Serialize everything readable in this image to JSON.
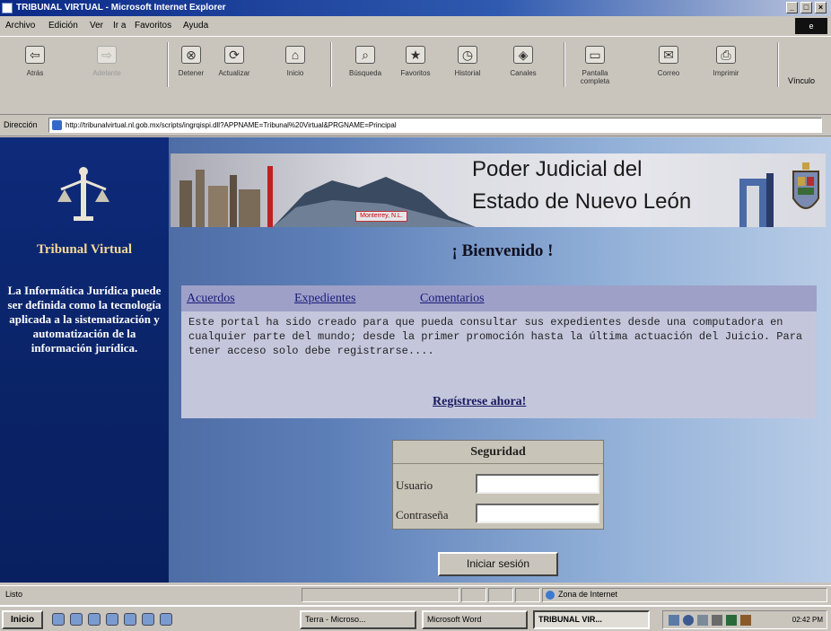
{
  "window": {
    "title": "TRIBUNAL VIRTUAL - Microsoft Internet Explorer"
  },
  "menu": [
    "Archivo",
    "Edición",
    "Ver",
    "Ir a",
    "Favoritos",
    "Ayuda"
  ],
  "toolbar": [
    {
      "label": "Atrás",
      "icon": "back-icon"
    },
    {
      "label": "Adelante",
      "icon": "forward-icon"
    },
    {
      "label": "Detener",
      "icon": "stop-icon"
    },
    {
      "label": "Actualizar",
      "icon": "refresh-icon"
    },
    {
      "label": "Inicio",
      "icon": "home-icon"
    },
    {
      "label": "Búsqueda",
      "icon": "search-icon"
    },
    {
      "label": "Favoritos",
      "icon": "favorites-icon"
    },
    {
      "label": "Historial",
      "icon": "history-icon"
    },
    {
      "label": "Canales",
      "icon": "channels-icon"
    },
    {
      "label": "Pantalla completa",
      "icon": "fullscreen-icon"
    },
    {
      "label": "Correo",
      "icon": "mail-icon"
    },
    {
      "label": "Imprimir",
      "icon": "print-icon"
    }
  ],
  "links_label": "Vínculo",
  "address": {
    "label": "Dirección",
    "url": "http://tribunalvirtual.nl.gob.mx/scripts/ingrqispi.dll?APPNAME=Tribunal%20Virtual&PRGNAME=Principal"
  },
  "sidebar": {
    "title": "Tribunal Virtual",
    "description": "La Informática Jurídica puede ser definida como la tecnología aplicada a la sistematización y automatización de la información jurídica."
  },
  "banner": {
    "line1": "Poder Judicial del",
    "line2": "Estado de Nuevo León",
    "caption": "Monterrey, N.L."
  },
  "welcome": "¡ Bienvenido !",
  "nav": [
    "Acuerdos",
    "Expedientes",
    "Comentarios"
  ],
  "intro": "Este portal ha sido creado para que pueda consultar sus expedientes desde una computadora en cualquier parte del mundo; desde la primer promoción hasta la última actuación del Juicio. Para tener acceso solo debe registrarse....",
  "register": "Regístrese ahora!",
  "login": {
    "heading": "Seguridad",
    "user_label": "Usuario",
    "user_value": "",
    "password_label": "Contraseña",
    "password_value": "",
    "button": "Iniciar sesión"
  },
  "status": {
    "left": "Listo",
    "zone": "Zona de Internet"
  },
  "taskbar": {
    "start": "Inicio",
    "tasks": [
      "Terra - Microso...",
      "Microsoft Word",
      "TRIBUNAL VIR..."
    ],
    "clock": "02:42 PM"
  },
  "colors": {
    "sidebar": "#0e2a7a",
    "title_accent": "#f5d994",
    "link": "#1a1a7a"
  }
}
